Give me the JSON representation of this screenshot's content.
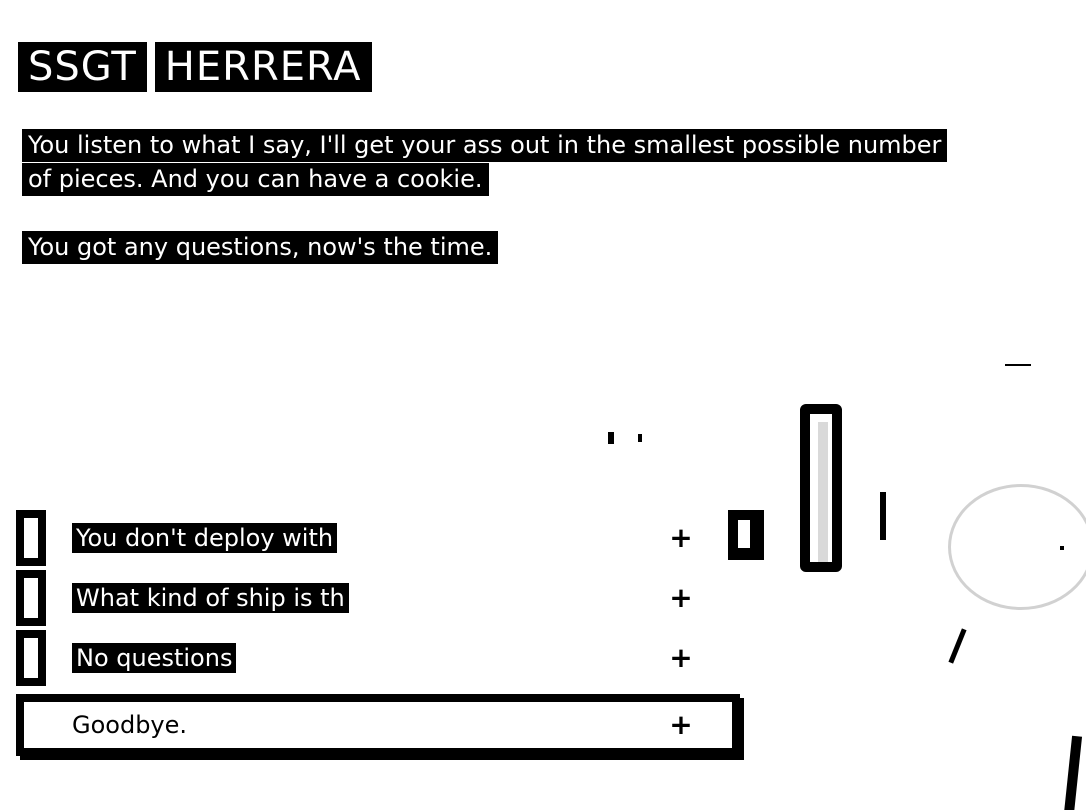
{
  "speaker": {
    "rank": "SSGT",
    "surname": "HERRERA"
  },
  "dialogue": {
    "line1": "You listen to what I say, I'll get your ass out in the smallest possible number of pieces. And you can have a cookie.",
    "line2": "You got any questions, now's the time."
  },
  "options": [
    {
      "label": "You don't deploy with",
      "icon": "plus-icon"
    },
    {
      "label": "What kind of ship is th",
      "icon": "plus-icon"
    },
    {
      "label": "No questions",
      "icon": "plus-icon"
    },
    {
      "label": "Goodbye.",
      "icon": "plus-icon",
      "selected": true
    }
  ],
  "option_glyph": "+",
  "colors": {
    "text_bg": "#000000",
    "text_fg": "#ffffff",
    "page_bg": "#ffffff"
  }
}
